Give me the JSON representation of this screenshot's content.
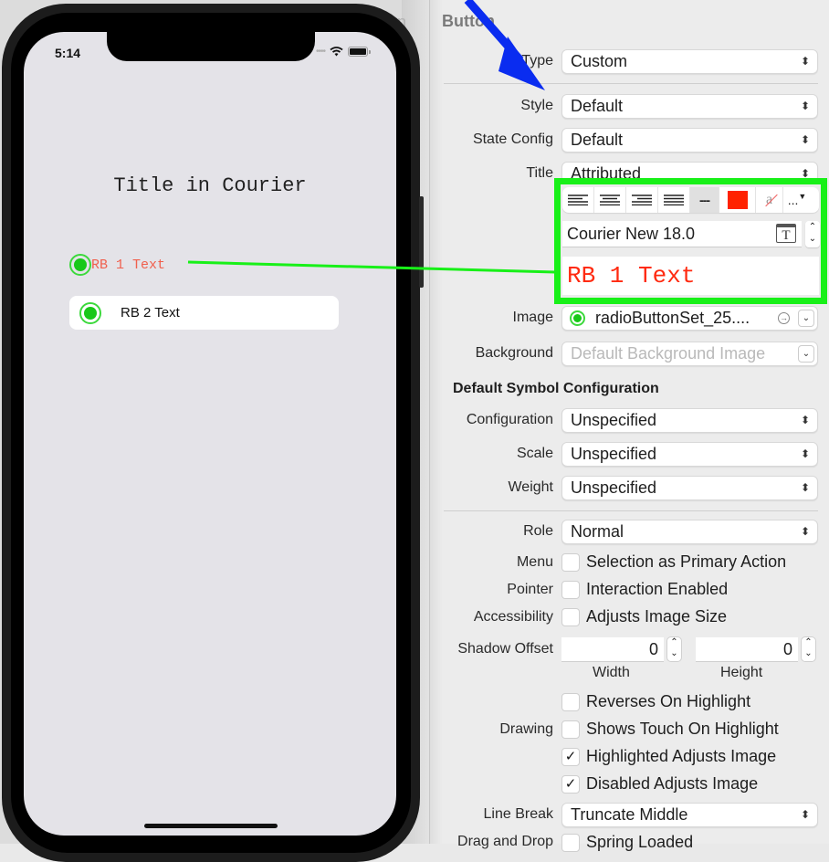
{
  "canvas": {
    "partial_tab_label": "on"
  },
  "phone": {
    "status_bar": {
      "time": "5:14",
      "signal_icon": "cellular-dots-icon",
      "wifi_icon": "wifi-icon",
      "battery_icon": "battery-icon"
    },
    "title": "Title in Courier",
    "radio_buttons": [
      {
        "label": "RB 1 Text",
        "selected": true,
        "label_color": "#f0604e"
      },
      {
        "label": "RB 2 Text",
        "selected": true
      }
    ]
  },
  "inspector": {
    "section_title": "Button",
    "type": {
      "label": "Type",
      "value": "Custom"
    },
    "style": {
      "label": "Style",
      "value": "Default"
    },
    "state_config": {
      "label": "State Config",
      "value": "Default"
    },
    "title": {
      "label": "Title",
      "value": "Attributed",
      "format_toolbar": {
        "align_buttons": [
          "align-left-icon",
          "align-center-icon",
          "align-right-icon",
          "align-justify-icon"
        ],
        "spacing_label": "---",
        "text_color": "#ff2200",
        "background_color_icon": "no-background-color-icon",
        "more_label": "..."
      },
      "font": "Courier New 18.0",
      "text": "RB 1 Text",
      "text_color": "#ff2a10"
    },
    "image": {
      "label": "Image",
      "value": "radioButtonSet_25...."
    },
    "background": {
      "label": "Background",
      "placeholder": "Default Background Image"
    },
    "symbol_config_header": "Default Symbol Configuration",
    "configuration": {
      "label": "Configuration",
      "value": "Unspecified"
    },
    "scale": {
      "label": "Scale",
      "value": "Unspecified"
    },
    "weight": {
      "label": "Weight",
      "value": "Unspecified"
    },
    "role": {
      "label": "Role",
      "value": "Normal"
    },
    "menu": {
      "label": "Menu",
      "checkbox_label": "Selection as Primary Action",
      "checked": false
    },
    "pointer": {
      "label": "Pointer",
      "checkbox_label": "Interaction Enabled",
      "checked": false
    },
    "accessibility": {
      "label": "Accessibility",
      "checkbox_label": "Adjusts Image Size",
      "checked": false
    },
    "shadow_offset": {
      "label": "Shadow Offset",
      "width_value": "0",
      "width_caption": "Width",
      "height_value": "0",
      "height_caption": "Height"
    },
    "drawing": {
      "label": "Drawing",
      "options": [
        {
          "label": "Reverses On Highlight",
          "checked": false
        },
        {
          "label": "Shows Touch On Highlight",
          "checked": false
        },
        {
          "label": "Highlighted Adjusts Image",
          "checked": true
        },
        {
          "label": "Disabled Adjusts Image",
          "checked": true
        }
      ]
    },
    "line_break": {
      "label": "Line Break",
      "value": "Truncate Middle"
    },
    "drag_and_drop": {
      "label": "Drag and Drop",
      "checkbox_label": "Spring Loaded",
      "checked": false
    }
  },
  "annotations": {
    "arrow_color": "#0a2cf0",
    "highlight_color": "#18f018"
  }
}
